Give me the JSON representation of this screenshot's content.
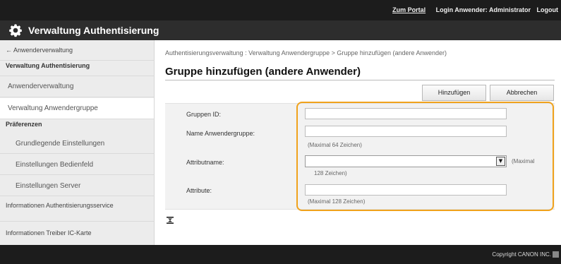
{
  "header": {
    "portal_link": "Zum Portal",
    "login_user": "Login Anwender:",
    "username": "Administrator",
    "logout": "Logout"
  },
  "app": {
    "title": "Verwaltung Authentisierung",
    "icon": "gear-icon"
  },
  "sidebar": {
    "back": "← Anwenderverwaltung",
    "heading_auth": "Verwaltung Authentisierung",
    "auth_users": "Anwenderverwaltung",
    "groups": "Verwaltung Anwendergruppe",
    "heading_prefs": "Präferenzen",
    "basic_settings": "Grundlegende Einstellungen",
    "panel_settings": "Einstellungen Bedienfeld",
    "server_settings": "Einstellungen Server",
    "auth_service_info": "Informationen Authentisierungsservice",
    "ic_card_info": "Informationen Treiber IC-Karte"
  },
  "main": {
    "breadcrumb": "Authentisierungsverwaltung : Verwaltung Anwendergruppe > Gruppe hinzufügen (andere Anwender)",
    "title": "Gruppe hinzufügen (andere Anwender)",
    "add_button": "Hinzufügen",
    "cancel_button": "Abbrechen"
  },
  "form": {
    "group_id_label": "Gruppen ID:",
    "group_id_value": "",
    "group_name_label": "Name Anwendergruppe:",
    "group_name_value": "",
    "group_name_hint": "(Maximal 64 Zeichen)",
    "attr_name_label": "Attributname:",
    "attr_name_value": "",
    "attr_name_hint_a": "(Maximal",
    "attr_name_hint_b": "128 Zeichen)",
    "attribute_label": "Attribute:",
    "attribute_value": "",
    "attribute_hint": "(Maximal 128 Zeichen)"
  },
  "footer": {
    "copyright": "Copyright CANON INC."
  },
  "colors": {
    "callout": "#f0a21c",
    "topbar": "#1c1c1c"
  }
}
